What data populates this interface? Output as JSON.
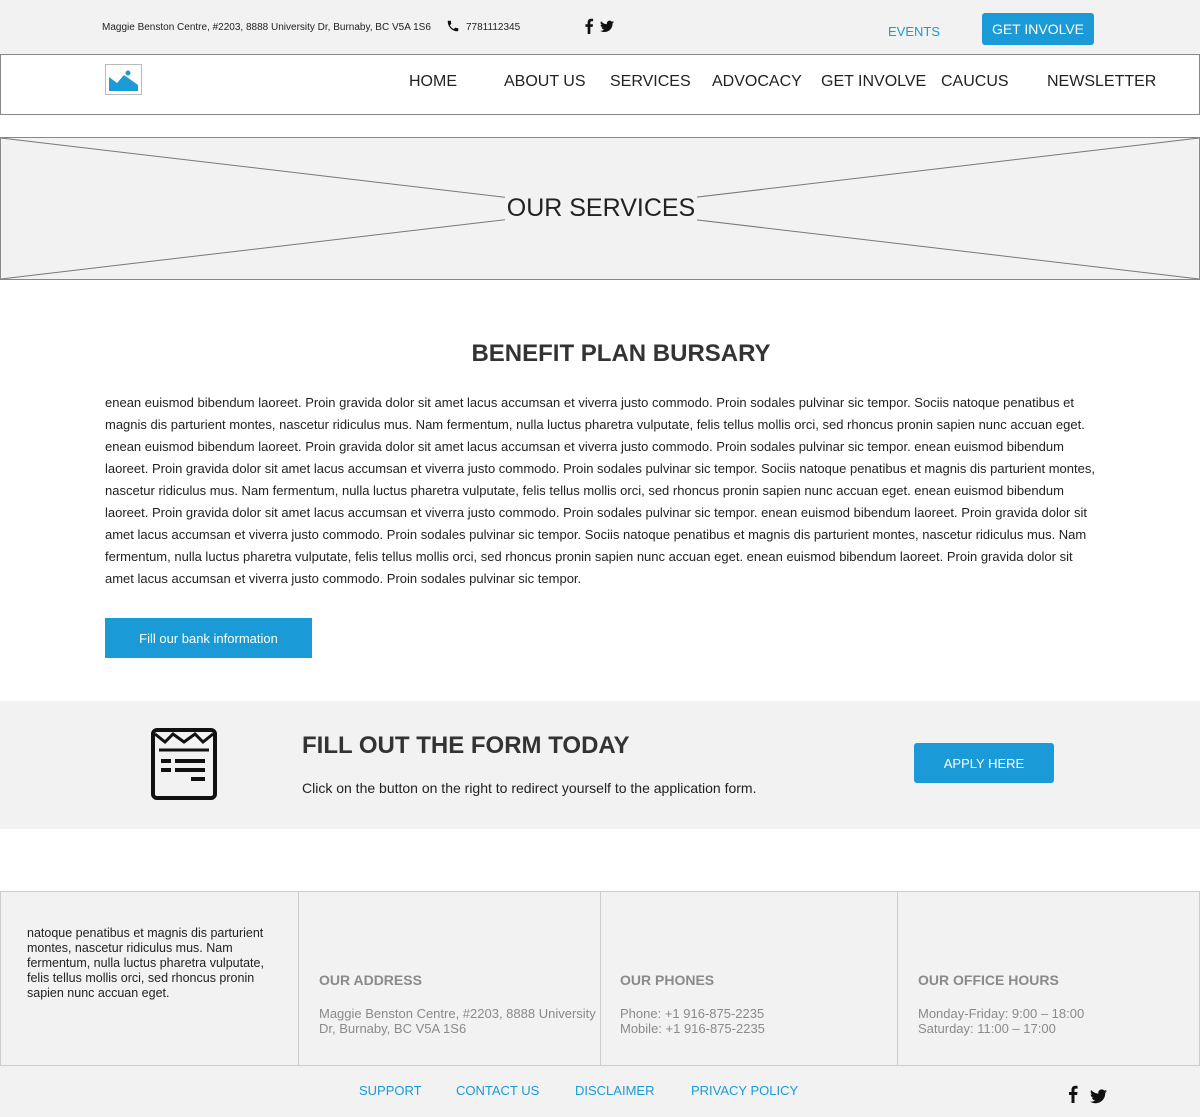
{
  "topbar": {
    "address": "Maggie Benston Centre, #2203, 8888 University Dr, Burnaby, BC V5A 1S6",
    "phone": "7781112345",
    "events_label": "EVENTS",
    "get_involve_label": "GET INVOLVE"
  },
  "nav": {
    "items": [
      {
        "label": "HOME"
      },
      {
        "label": "ABOUT US"
      },
      {
        "label": "SERVICES"
      },
      {
        "label": "ADVOCACY"
      },
      {
        "label": "GET INVOLVE"
      },
      {
        "label": "CAUCUS"
      },
      {
        "label": "NEWSLETTER"
      }
    ]
  },
  "hero": {
    "title": "OUR SERVICES"
  },
  "main": {
    "title": "BENEFIT PLAN BURSARY",
    "paragraph": "enean euismod bibendum laoreet. Proin gravida dolor sit amet lacus accumsan et viverra justo commodo. Proin sodales pulvinar sic tempor. Sociis natoque penatibus et magnis dis parturient montes, nascetur ridiculus mus. Nam fermentum, nulla luctus pharetra vulputate, felis tellus mollis orci, sed rhoncus pronin sapien nunc accuan eget. enean euismod bibendum laoreet. Proin gravida dolor sit amet lacus accumsan et viverra justo commodo. Proin sodales pulvinar sic tempor.",
    "bank_button_label": "Fill our bank information"
  },
  "cta": {
    "title": "FILL OUT THE FORM TODAY",
    "text": "Click on the button on the right to redirect yourself to the application form.",
    "apply_label": "APPLY HERE"
  },
  "footer": {
    "about": "natoque penatibus et magnis dis parturient montes, nascetur ridiculus mus. Nam fermentum, nulla luctus pharetra vulputate, felis tellus mollis orci, sed rhoncus pronin sapien nunc accuan eget.",
    "address_heading": "OUR ADDRESS",
    "address_text": "Maggie Benston Centre, #2203, 8888 University Dr, Burnaby, BC V5A 1S6",
    "phones_heading": "OUR PHONES",
    "phone_line": "Phone: +1 916-875-2235",
    "mobile_line": "Mobile: +1 916-875-2235",
    "hours_heading": "OUR OFFICE HOURS",
    "hours_weekday": "Monday-Friday: 9:00 – 18:00",
    "hours_saturday": "Saturday: 11:00 – 17:00"
  },
  "bottom_links": {
    "support": "SUPPORT",
    "contact": "CONTACT US",
    "disclaimer": "DISCLAIMER",
    "privacy": "PRIVACY POLICY"
  },
  "icons": {
    "phone": "phone-icon",
    "facebook": "facebook-icon",
    "twitter": "twitter-icon",
    "logo": "image-placeholder-icon",
    "form": "form-icon"
  },
  "colors": {
    "accent": "#1a9ad6",
    "band_bg": "#f2f2f2",
    "muted_text": "#8a8a8a"
  }
}
